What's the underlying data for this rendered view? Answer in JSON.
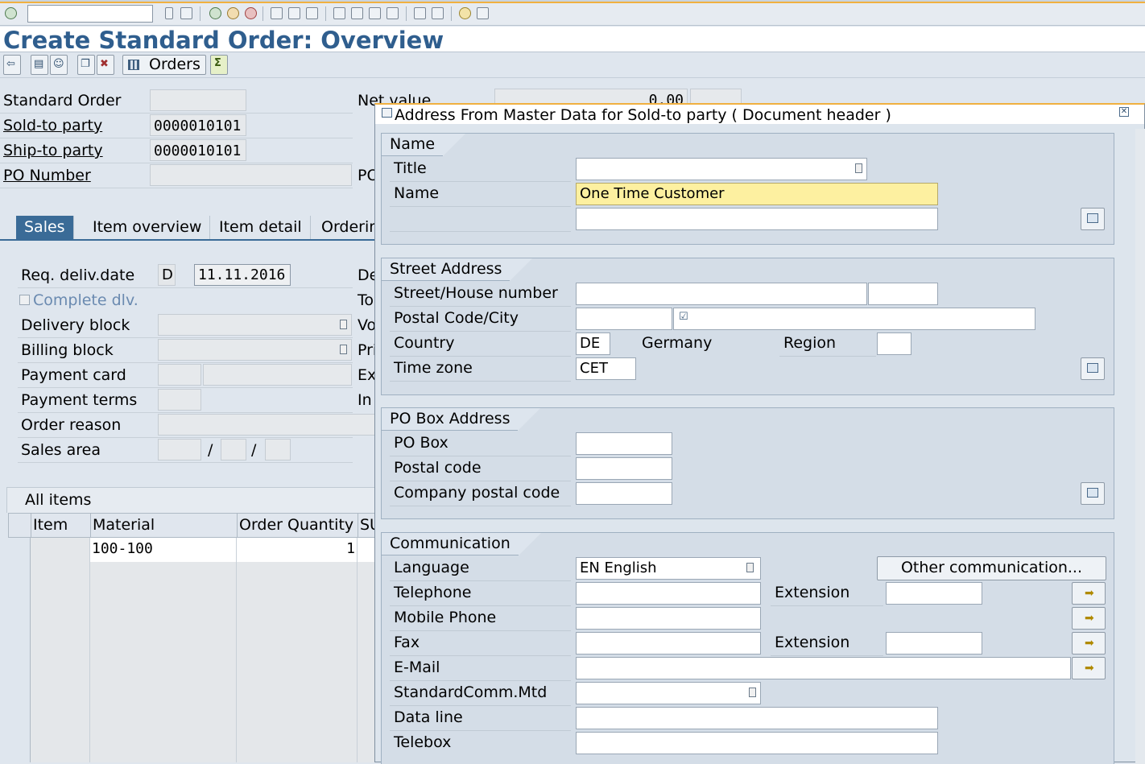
{
  "page": {
    "title": "Create Standard Order: Overview",
    "orders_button": "Orders"
  },
  "header": {
    "standard_order_label": "Standard Order",
    "sold_to_label": "Sold-to party",
    "sold_to_value": "0000010101",
    "ship_to_label": "Ship-to party",
    "ship_to_value": "0000010101",
    "po_number_label": "PO Number",
    "net_value_label": "Net value",
    "net_value": "0.00",
    "po_partial": "PO"
  },
  "tabs": [
    "Sales",
    "Item overview",
    "Item detail",
    "Orderin"
  ],
  "sales": {
    "req_deliv_label": "Req. deliv.date",
    "req_deliv_unit": "D",
    "req_deliv_value": "11.11.2016",
    "complete_dlv_label": "Complete dlv.",
    "delivery_block_label": "Delivery block",
    "billing_block_label": "Billing block",
    "payment_card_label": "Payment card",
    "payment_terms_label": "Payment terms",
    "order_reason_label": "Order reason",
    "sales_area_label": "Sales area",
    "sales_area_sep": "/",
    "right_partial": [
      "De",
      "To",
      "Vo",
      "Pri",
      "Ex",
      "In"
    ]
  },
  "items": {
    "title": "All items",
    "columns": [
      "Item",
      "Material",
      "Order Quantity",
      "SU"
    ],
    "rows": [
      {
        "item": "",
        "material": "100-100",
        "qty": "1"
      }
    ]
  },
  "dialog": {
    "title": "Address From Master Data for Sold-to party ( Document header )",
    "name_group": {
      "title": "Name",
      "title_label": "Title",
      "name_label": "Name",
      "name_value": "One Time  Customer"
    },
    "street_group": {
      "title": "Street Address",
      "street_label": "Street/House number",
      "postal_city_label": "Postal Code/City",
      "country_label": "Country",
      "country_value": "DE",
      "country_name": "Germany",
      "region_label": "Region",
      "timezone_label": "Time zone",
      "timezone_value": "CET"
    },
    "pobox_group": {
      "title": "PO Box Address",
      "pobox_label": "PO Box",
      "postal_code_label": "Postal code",
      "company_postal_label": "Company postal code"
    },
    "comm_group": {
      "title": "Communication",
      "language_label": "Language",
      "language_value": "EN English",
      "other_comm_button": "Other communication...",
      "telephone_label": "Telephone",
      "extension_label": "Extension",
      "mobile_label": "Mobile Phone",
      "fax_label": "Fax",
      "fax_extension_label": "Extension",
      "email_label": "E-Mail",
      "std_comm_label": "StandardComm.Mtd",
      "data_line_label": "Data line",
      "telebox_label": "Telebox"
    }
  },
  "colors": {
    "title_blue": "#2f5e8e",
    "tab_active": "#3a6b97",
    "highlight_yellow": "#fdf0a0",
    "accent_orange": "#f0b040"
  }
}
